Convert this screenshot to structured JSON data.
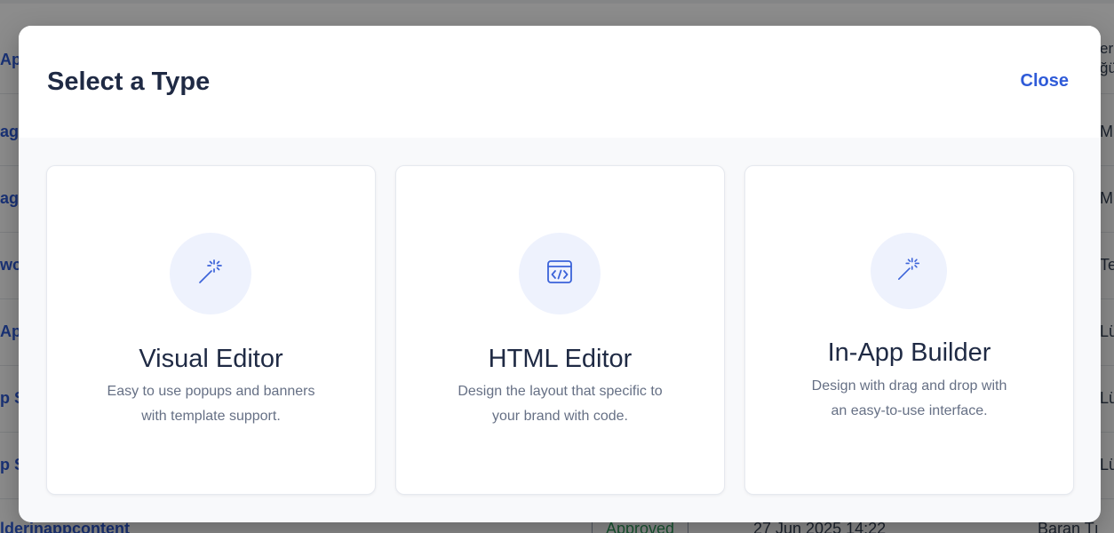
{
  "background": {
    "row_left_text": [
      "Ap",
      "ag",
      "ag",
      "wc",
      "Ap",
      "p S",
      "p S"
    ],
    "row_right_text": [
      "er\nğü",
      "M",
      "M",
      "Te",
      "Lü",
      "Lü",
      "Lü"
    ],
    "bottom_row": {
      "name": "lderinappcontent",
      "status": "Approved",
      "date": "27 Jun 2025 14:22",
      "user": "Baran Tı"
    }
  },
  "modal": {
    "title": "Select a Type",
    "close_label": "Close",
    "cards": [
      {
        "icon": "magic-wand-icon",
        "title": "Visual Editor",
        "description_line1": "Easy to use popups and banners",
        "description_line2": "with template support."
      },
      {
        "icon": "code-window-icon",
        "title": "HTML Editor",
        "description_line1": "Design the layout that specific to",
        "description_line2": "your brand with code."
      },
      {
        "icon": "magic-wand-icon",
        "title": "In-App Builder",
        "description_line1": "Design with drag and drop with",
        "description_line2": "an easy-to-use interface."
      }
    ]
  },
  "colors": {
    "accent": "#2f5bd8",
    "title": "#1f2a44",
    "description": "#667085",
    "icon_circle": "#eef2fd",
    "approved": "#2e9b5b"
  }
}
